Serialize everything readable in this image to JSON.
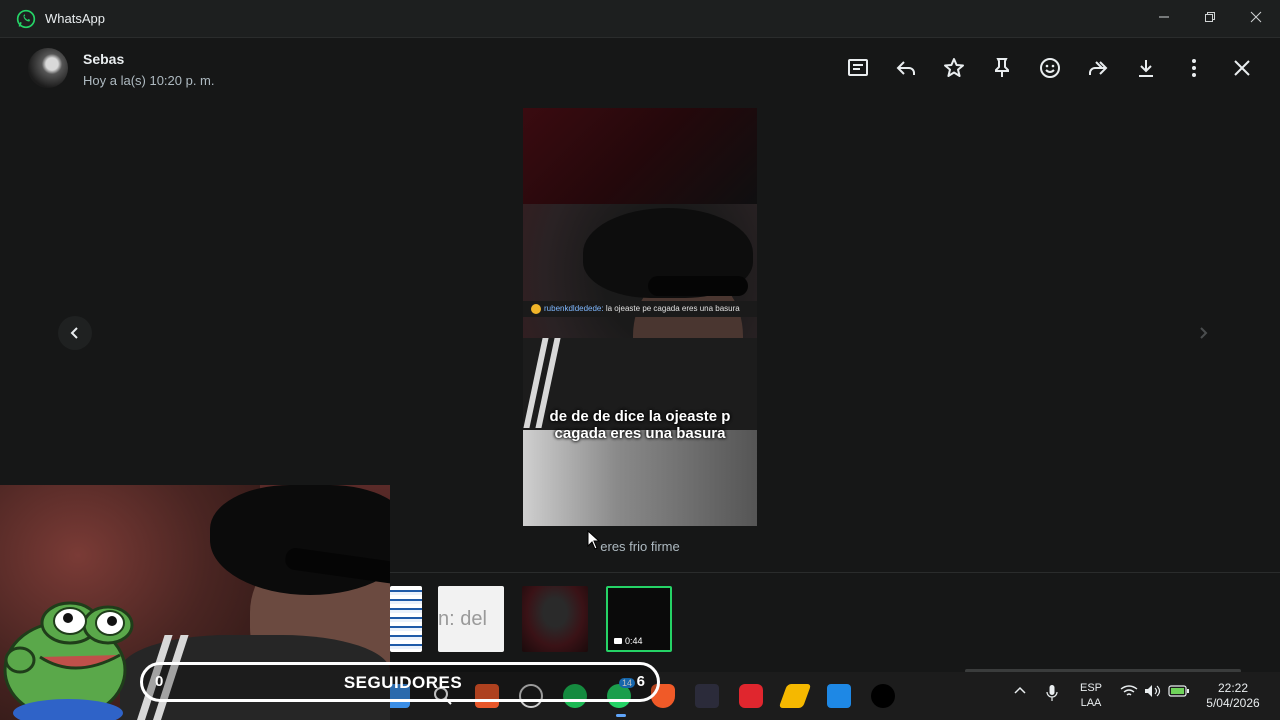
{
  "window": {
    "app_title": "WhatsApp",
    "controls": [
      "minimize",
      "restore",
      "close"
    ]
  },
  "viewer": {
    "sender_name": "Sebas",
    "sender_time": "Hoy a la(s) 10:20 p. m.",
    "header_icons": [
      "message-icon",
      "reply-icon",
      "star-icon",
      "pin-icon",
      "emoji-icon",
      "forward-icon",
      "download-icon",
      "more-icon",
      "close-icon"
    ],
    "caption": "eres frio firme",
    "media": {
      "comment_user": "rubenkdldedede:",
      "comment_text": "la ojeaste pe cagada eres una basura",
      "subtitle": "de de de dice la ojeaste p cagada eres una basura"
    }
  },
  "thumbnails": {
    "thumb2_text": "n: del",
    "thumb4_duration": "0:44"
  },
  "overlay": {
    "followers_left": "0",
    "followers_label": "SEGUIDORES",
    "followers_right": "6"
  },
  "taskbar": {
    "whatsapp_badge": "14",
    "language_line1": "ESP",
    "language_line2": "LAA",
    "time": "22:22",
    "date": "5/04/2026"
  },
  "colors": {
    "accent": "#25d366",
    "background": "#161717"
  }
}
